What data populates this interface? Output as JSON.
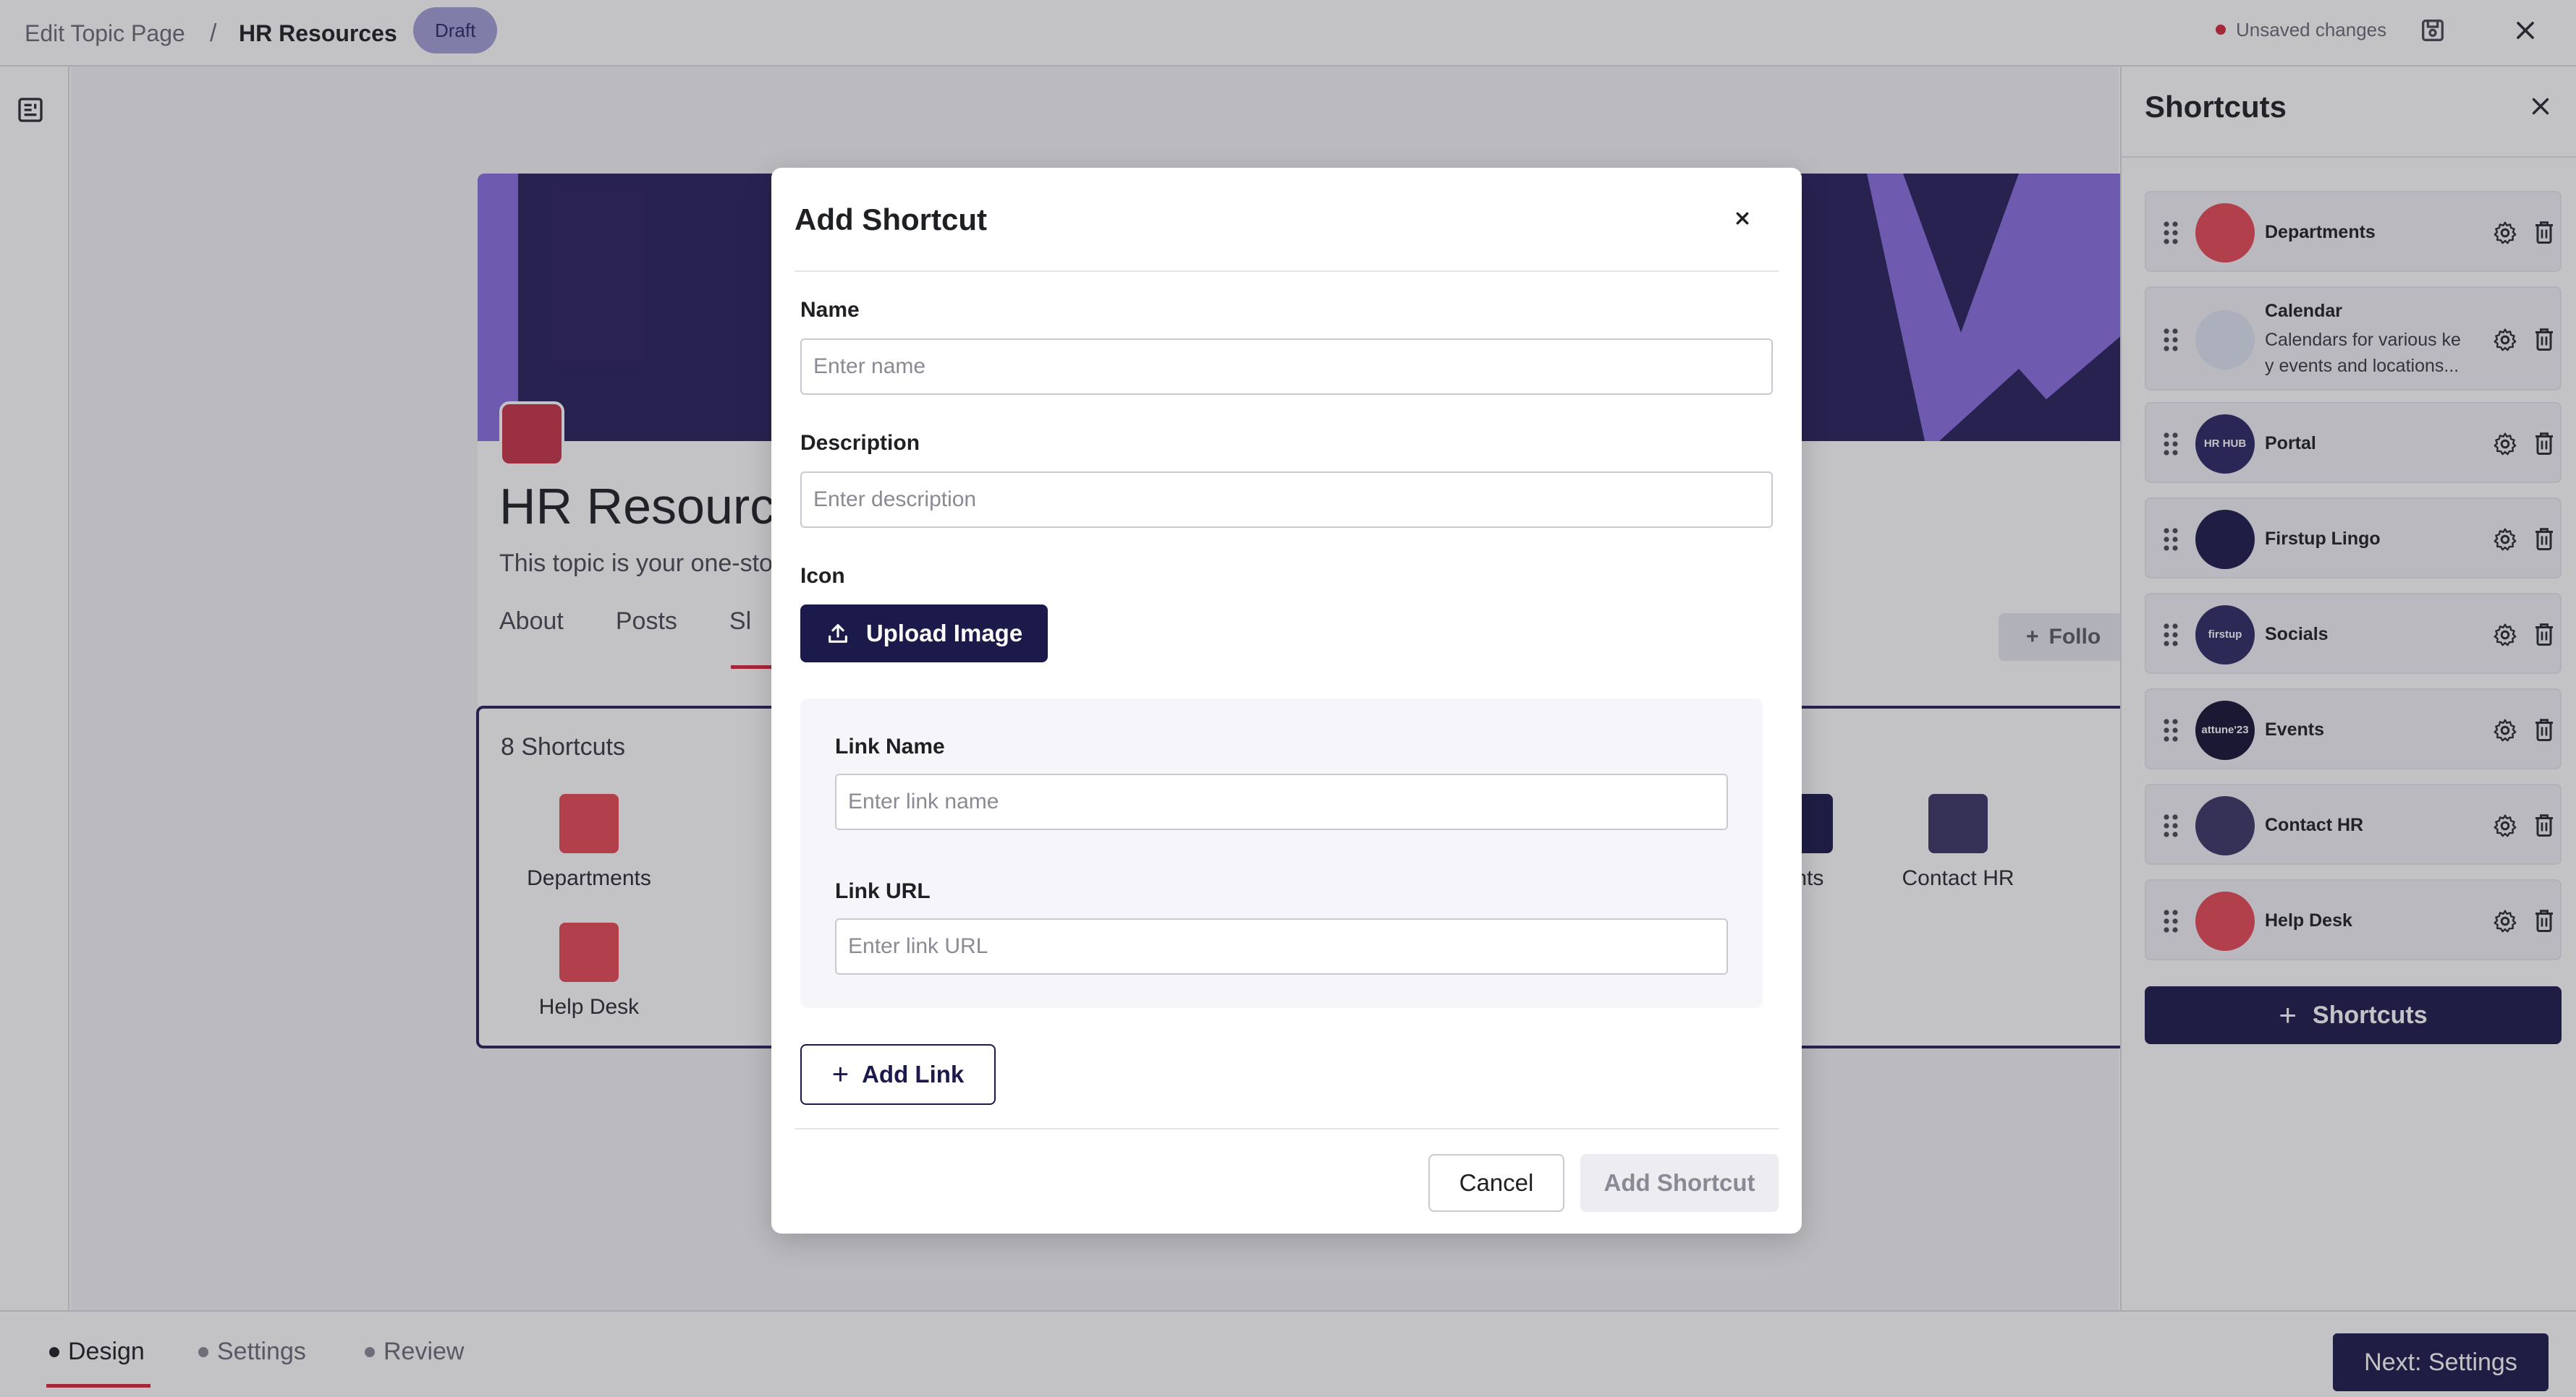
{
  "topbar": {
    "breadcrumb_parent": "Edit Topic Page",
    "breadcrumb_separator": "/",
    "breadcrumb_current": "HR Resources",
    "status_badge": "Draft",
    "unsaved_text": "Unsaved changes",
    "unsaved_dot_color": "#d7263d",
    "save_icon": "save-icon",
    "close_icon": "close-icon"
  },
  "left_rail": {
    "icon": "page-layout-icon"
  },
  "topic": {
    "title": "HR Resource",
    "subtitle": "This topic is your one-sto",
    "tabs": [
      "About",
      "Posts",
      "Sl"
    ],
    "follow_label": "Follo"
  },
  "shortcuts_section": {
    "count_label": "8 Shortcuts",
    "tiles": [
      {
        "label": "Departments",
        "icon": "departments-icon"
      },
      {
        "label": "ents",
        "icon": "events-icon"
      },
      {
        "label": "Contact HR",
        "icon": "contact-hr-icon"
      },
      {
        "label": "Help Desk",
        "icon": "help-desk-icon"
      }
    ]
  },
  "right_panel": {
    "title": "Shortcuts",
    "items": [
      {
        "name": "Departments",
        "description": "",
        "thumb": "departments-thumb"
      },
      {
        "name": "Calendar",
        "description": "Calendars for various ke y events and locations...",
        "thumb": "calendar-thumb"
      },
      {
        "name": "Portal",
        "description": "",
        "thumb": "portal-thumb",
        "thumb_text": "HR HUB"
      },
      {
        "name": "Firstup Lingo",
        "description": "",
        "thumb": "megaphone-thumb"
      },
      {
        "name": "Socials",
        "description": "",
        "thumb": "socials-thumb",
        "thumb_text": "firstup"
      },
      {
        "name": "Events",
        "description": "",
        "thumb": "events-thumb",
        "thumb_text": "attune'23"
      },
      {
        "name": "Contact HR",
        "description": "",
        "thumb": "contact-hr-thumb"
      },
      {
        "name": "Help Desk",
        "description": "",
        "thumb": "help-desk-thumb"
      }
    ],
    "add_button_label": "Shortcuts"
  },
  "modal": {
    "title": "Add Shortcut",
    "name_label": "Name",
    "name_placeholder": "Enter name",
    "description_label": "Description",
    "description_placeholder": "Enter description",
    "icon_label": "Icon",
    "upload_label": "Upload Image",
    "link_name_label": "Link Name",
    "link_name_placeholder": "Enter link name",
    "link_url_label": "Link URL",
    "link_url_placeholder": "Enter link URL",
    "add_link_label": "Add Link",
    "cancel_label": "Cancel",
    "submit_label": "Add Shortcut"
  },
  "bottombar": {
    "steps": [
      "Design",
      "Settings",
      "Review"
    ],
    "active_step": "Design",
    "next_label": "Next: Settings"
  },
  "colors": {
    "navy": "#1c1a4a",
    "accent_red": "#d7263d",
    "banner_purple": "#29205e",
    "banner_light": "#8a6fe0",
    "draft_badge": "#a39fd6"
  }
}
